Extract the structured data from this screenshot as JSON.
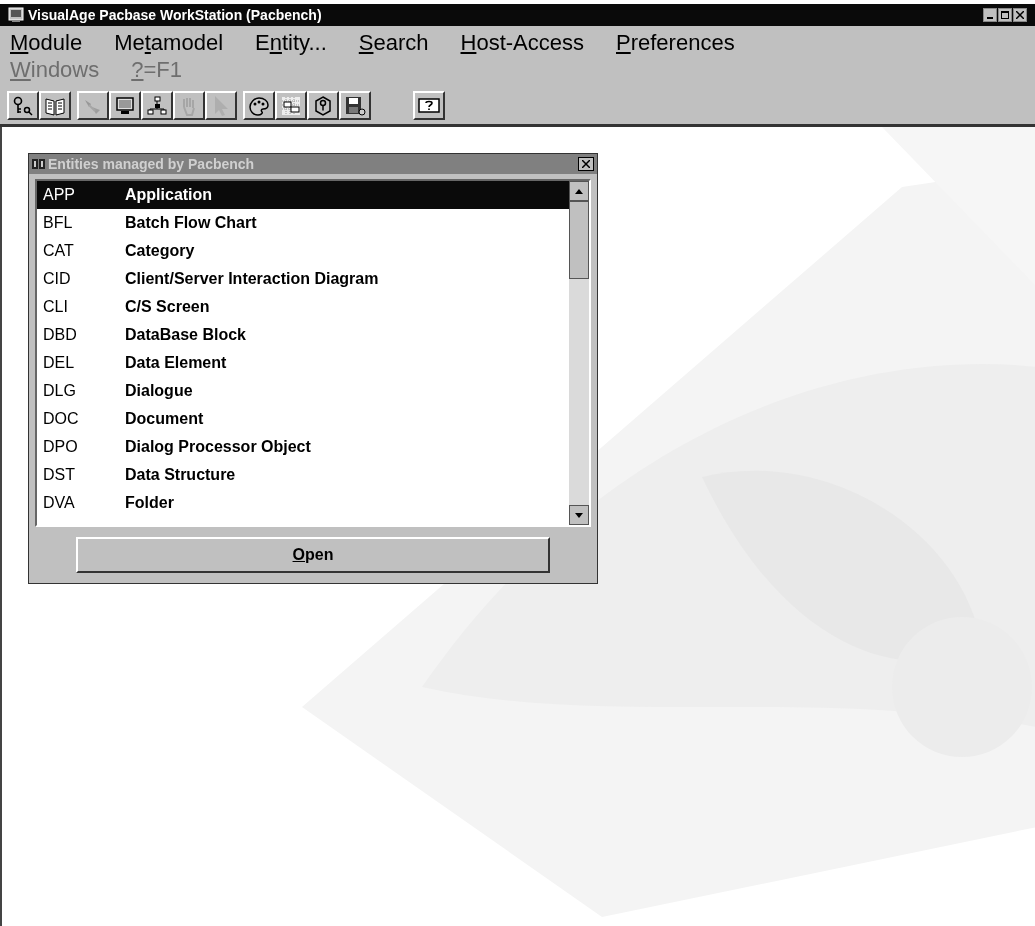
{
  "window": {
    "title": "VisualAge Pacbase WorkStation (Pacbench)"
  },
  "menu": [
    {
      "key": "M",
      "post": "odule",
      "disabled": false
    },
    {
      "pre": "Me",
      "key": "t",
      "post": "amodel",
      "disabled": false
    },
    {
      "pre": "E",
      "key": "n",
      "post": "tity...",
      "disabled": false
    },
    {
      "key": "S",
      "post": "earch",
      "disabled": false
    },
    {
      "key": "H",
      "post": "ost-Access",
      "disabled": false
    },
    {
      "key": "P",
      "post": "references",
      "disabled": false
    },
    {
      "key": "W",
      "post": "indows",
      "disabled": true
    },
    {
      "key": "?",
      "post": "=F1",
      "disabled": true
    }
  ],
  "toolbar": [
    [
      {
        "kind": "key",
        "disabled": false
      },
      {
        "kind": "book",
        "disabled": false
      }
    ],
    [
      {
        "kind": "link",
        "disabled": true
      },
      {
        "kind": "monitor",
        "disabled": false
      },
      {
        "kind": "tree",
        "disabled": false
      },
      {
        "kind": "hand",
        "disabled": true
      },
      {
        "kind": "pointer",
        "disabled": true
      }
    ],
    [
      {
        "kind": "palette",
        "disabled": false
      },
      {
        "kind": "grid",
        "disabled": false
      },
      {
        "kind": "help",
        "disabled": false
      },
      {
        "kind": "disk",
        "disabled": false
      }
    ],
    [
      {
        "kind": "question",
        "disabled": false
      }
    ]
  ],
  "dialog": {
    "title": "Entities managed by Pacbench",
    "rows": [
      {
        "code": "APP",
        "name": "Application",
        "selected": true
      },
      {
        "code": "BFL",
        "name": "Batch Flow Chart",
        "selected": false
      },
      {
        "code": "CAT",
        "name": "Category",
        "selected": false
      },
      {
        "code": "CID",
        "name": "Client/Server Interaction Diagram",
        "selected": false
      },
      {
        "code": "CLI",
        "name": "C/S Screen",
        "selected": false
      },
      {
        "code": "DBD",
        "name": "DataBase Block",
        "selected": false
      },
      {
        "code": "DEL",
        "name": "Data Element",
        "selected": false
      },
      {
        "code": "DLG",
        "name": "Dialogue",
        "selected": false
      },
      {
        "code": "DOC",
        "name": "Document",
        "selected": false
      },
      {
        "code": "DPO",
        "name": "Dialog Processor Object",
        "selected": false
      },
      {
        "code": "DST",
        "name": "Data Structure",
        "selected": false
      },
      {
        "code": "DVA",
        "name": "Folder",
        "selected": false
      }
    ],
    "button": {
      "key": "O",
      "post": "pen"
    }
  }
}
